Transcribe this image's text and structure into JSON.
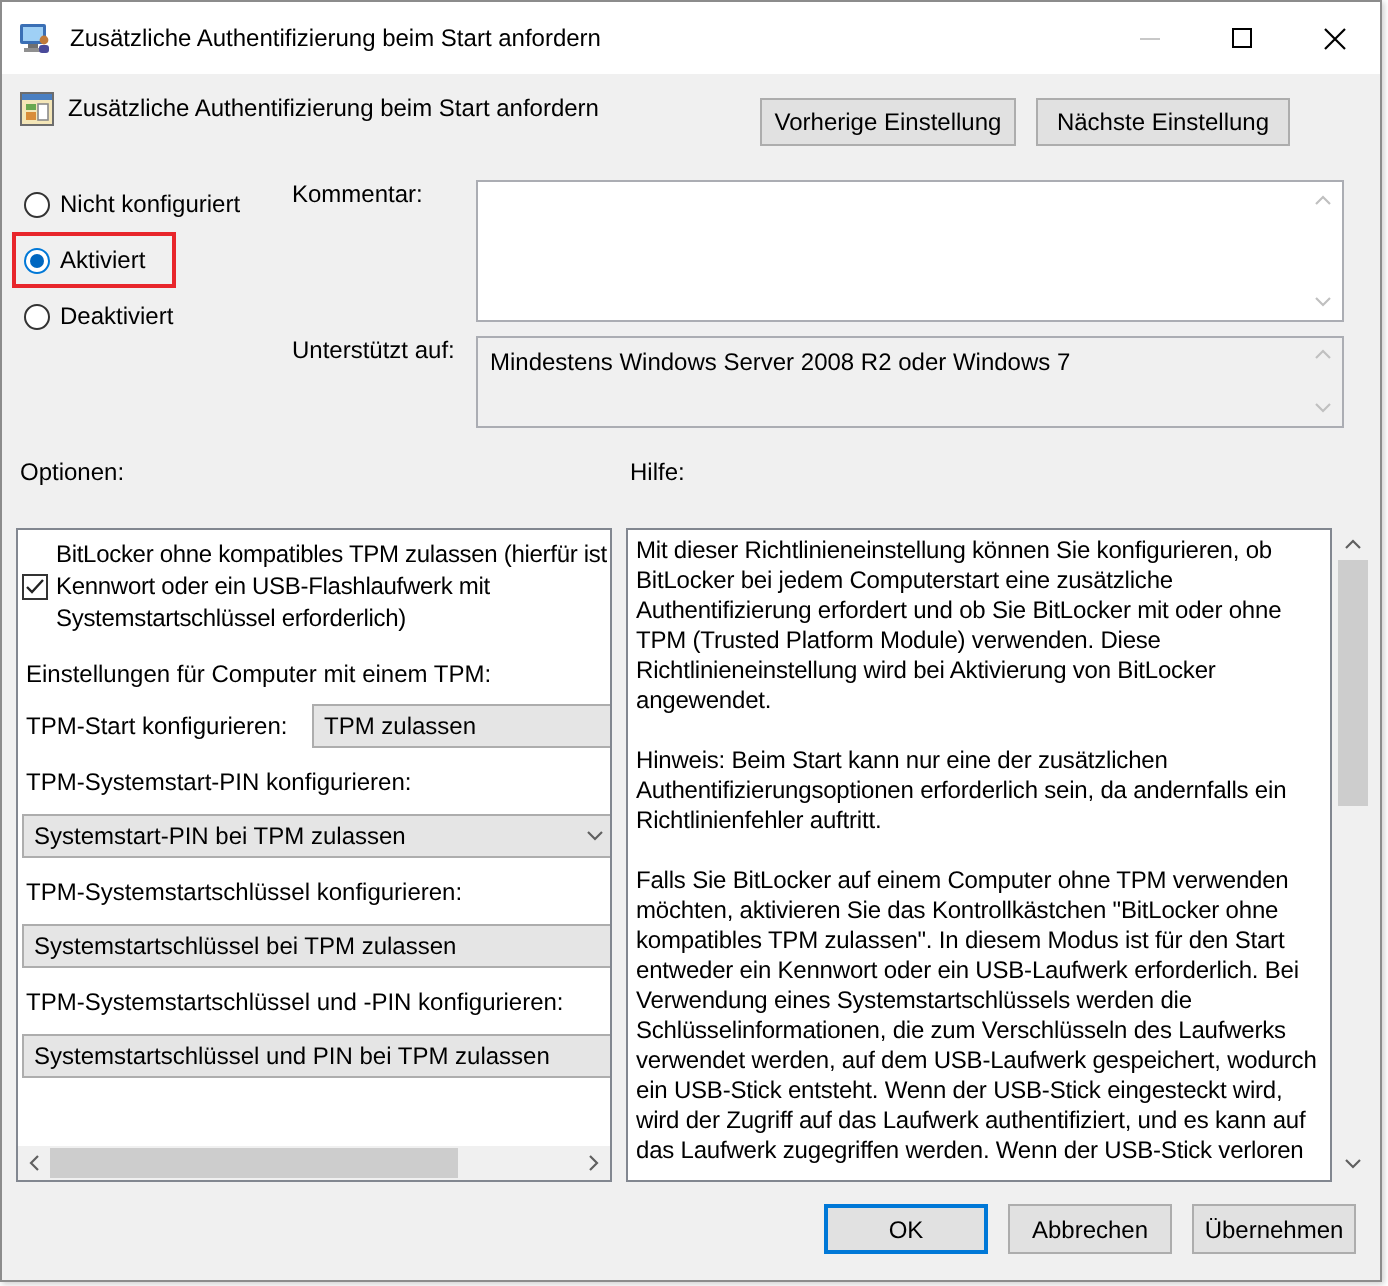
{
  "window": {
    "title": "Zusätzliche Authentifizierung beim Start anfordern",
    "minimize_disabled": true
  },
  "header": {
    "policy_name": "Zusätzliche Authentifizierung beim Start anfordern",
    "buttons": [
      {
        "label": "Vorherige Einstellung"
      },
      {
        "label": "Nächste Einstellung"
      }
    ]
  },
  "state_options": [
    {
      "label": "Nicht konfiguriert",
      "selected": false,
      "highlighted": false
    },
    {
      "label": "Aktiviert",
      "selected": true,
      "highlighted": true
    },
    {
      "label": "Deaktiviert",
      "selected": false,
      "highlighted": false
    }
  ],
  "comment": {
    "label": "Kommentar:"
  },
  "supported_on": {
    "label": "Unterstützt auf:",
    "value": "Mindestens Windows Server 2008 R2 oder Windows 7"
  },
  "options": {
    "label": "Optionen:",
    "items": [
      {
        "kind": "checkbox",
        "label": "BitLocker ohne kompatibles TPM zulassen (hierfür ist\nKennwort oder ein USB-Flashlaufwerk mit\nSystemstartschlüssel erforderlich)",
        "checked": true
      },
      {
        "kind": "heading",
        "label": "Einstellungen für Computer mit einem TPM:"
      },
      {
        "kind": "inline_select",
        "label": "TPM-Start konfigurieren:",
        "value": "TPM zulassen",
        "dropdown_arrow": false
      },
      {
        "kind": "select",
        "label": "TPM-Systemstart-PIN konfigurieren:",
        "value": "Systemstart-PIN bei TPM zulassen",
        "dropdown_arrow": true
      },
      {
        "kind": "select",
        "label": "TPM-Systemstartschlüssel konfigurieren:",
        "value": "Systemstartschlüssel bei TPM zulassen",
        "dropdown_arrow": false
      },
      {
        "kind": "select",
        "label": "TPM-Systemstartschlüssel und -PIN konfigurieren:",
        "value": "Systemstartschlüssel und PIN bei TPM zulassen",
        "dropdown_arrow": false
      }
    ]
  },
  "help": {
    "label": "Hilfe:",
    "paragraphs": [
      "Mit dieser Richtlinieneinstellung können Sie konfigurieren, ob BitLocker bei jedem Computerstart eine zusätzliche Authentifizierung erfordert und ob Sie BitLocker mit oder ohne TPM (Trusted Platform Module) verwenden. Diese Richtlinieneinstellung wird bei Aktivierung von BitLocker angewendet.",
      "Hinweis: Beim Start kann nur eine der zusätzlichen Authentifizierungsoptionen erforderlich sein, da andernfalls ein Richtlinienfehler auftritt.",
      "Falls Sie BitLocker auf einem Computer ohne TPM verwenden möchten, aktivieren Sie das Kontrollkästchen \"BitLocker ohne kompatibles TPM zulassen\". In diesem Modus ist für den Start entweder ein Kennwort oder ein USB-Laufwerk erforderlich. Bei Verwendung eines Systemstartschlüssels werden die Schlüsselinformationen, die zum Verschlüsseln des Laufwerks verwendet werden, auf dem USB-Laufwerk gespeichert, wodurch ein USB-Stick entsteht. Wenn der USB-Stick eingesteckt wird, wird der Zugriff auf das Laufwerk authentifiziert, und es kann auf das Laufwerk zugegriffen werden. Wenn der USB-Stick verloren"
    ]
  },
  "buttons": [
    {
      "label": "OK",
      "default": true
    },
    {
      "label": "Abbrechen",
      "default": false
    },
    {
      "label": "Übernehmen",
      "default": false
    }
  ]
}
